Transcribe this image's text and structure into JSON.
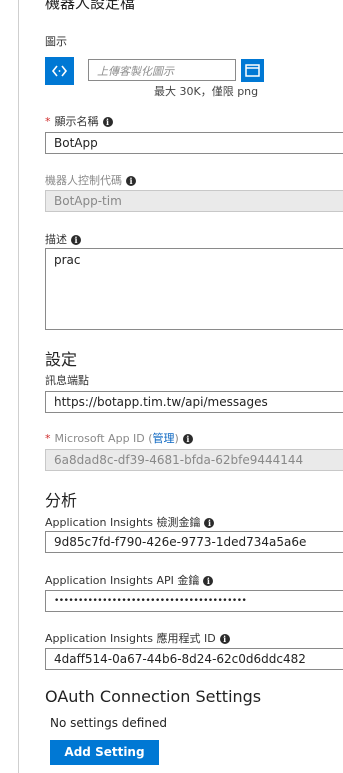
{
  "page_title": "機器人設定檔",
  "icon_section": {
    "label": "圖示",
    "upload_placeholder": "上傳客製化圖示",
    "size_note": "最大 30K，僅限 png"
  },
  "display_name": {
    "label": "顯示名稱",
    "value": "BotApp"
  },
  "bot_handle": {
    "label": "機器人控制代碼",
    "value": "BotApp-tim"
  },
  "description": {
    "label": "描述",
    "value": "prac"
  },
  "settings": {
    "heading": "設定",
    "endpoint_label": "訊息端點",
    "endpoint_value": "https://botapp.tim.tw/api/messages",
    "app_id_label_prefix": "Microsoft App ID (",
    "app_id_link": "管理",
    "app_id_label_suffix": ")",
    "app_id_value": "6a8dad8c-df39-4681-bfda-62bfe9444144"
  },
  "analytics": {
    "heading": "分析",
    "instrumentation_key_label": "Application Insights 檢測金鑰",
    "instrumentation_key_value": "9d85c7fd-f790-426e-9773-1ded734a5a6e",
    "api_key_label": "Application Insights API 金鑰",
    "api_key_value": "••••••••••••••••••••••••••••••••••••••••",
    "app_id_label": "Application Insights 應用程式 ID",
    "app_id_value": "4daff514-0a67-44b6-8d24-62c0d6ddc482"
  },
  "oauth": {
    "heading": "OAuth Connection Settings",
    "empty_text": "No settings defined",
    "add_button": "Add Setting"
  },
  "colors": {
    "accent": "#0078d4",
    "required": "#d02c2c",
    "link": "#0a66c2"
  }
}
